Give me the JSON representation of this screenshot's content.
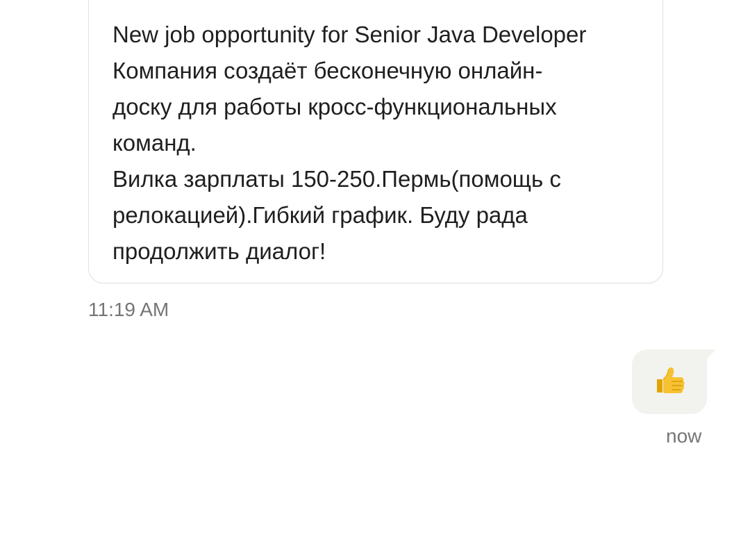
{
  "incoming_message": {
    "lines": [
      "New job opportunity for Senior Java Developer",
      "Компания создаёт бесконечную онлайн-",
      "доску для работы кросс-функциональных",
      "команд.",
      "Вилка зарплаты 150-250.Пермь(помощь с",
      "релокацией).Гибкий график. Буду рада",
      "продолжить диалог!"
    ],
    "time": "11:19 AM"
  },
  "outgoing_message": {
    "emoji": "thumbs-up-icon",
    "time": "now"
  },
  "colors": {
    "text": "#1f1f1f",
    "timestamp": "#757575",
    "incoming_border": "#e2e2e2",
    "outgoing_bg": "#f2f2ee",
    "thumb_yellow": "#f6c234"
  }
}
